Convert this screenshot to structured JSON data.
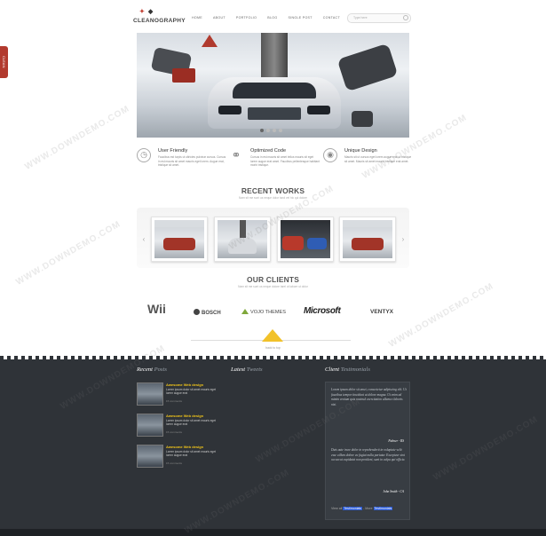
{
  "side_tab": {
    "label": "CLEAN"
  },
  "header": {
    "logo_mark": "CLEANOGRAPHY",
    "logo_text": "CLEANOGRAPHY",
    "nav": [
      "HOME",
      "ABOUT",
      "PORTFOLIO",
      "BLOG",
      "SINGLE POST",
      "CONTACT"
    ],
    "search_placeholder": "Type here"
  },
  "features": [
    {
      "title": "User Friendly",
      "text": "Faucibus est turpis ut ultricies pulvinar cursus. Cursus in est mauris sit amet mauris eget lorem. Augue erat, tristique sit amet."
    },
    {
      "title": "Optimized Code",
      "text": "Cursus in est mauris sit amet tellus mauris sit eget lorem augue erat amet. Faucibus pellentesque habitant morbi tristique."
    },
    {
      "title": "Unique Design",
      "text": "Mauris sit ut cursus eget lorem augue erat ut tristique sit amet. Mauris sit amet mauris tristique erat amet."
    }
  ],
  "recent_works": {
    "title": "RECENT WORKS",
    "subtitle": "Nam sit me sunt us neque dolor tarol vel hic qui dolore"
  },
  "clients": {
    "title": "OUR CLIENTS",
    "subtitle": "Nam sit me sunt us neque dolore tarel ut labore ut dolor",
    "logos": [
      "Wii",
      "BOSCH",
      "VOJO THEMES",
      "Microsoft",
      "VENTYX"
    ]
  },
  "back_to_top": "back to top",
  "footer": {
    "recent_posts_heading": "Recent",
    "recent_posts_accent": "Posts",
    "latest_tweets_heading": "Latest",
    "latest_tweets_accent": "Tweets",
    "testimonials_heading": "Client",
    "testimonials_accent": "Testimonials",
    "posts": [
      {
        "title": "Awesome Web design",
        "text": "Lorem ipsum dolor sit amet mauris eget lorem augue erat",
        "meta": "15 comments"
      },
      {
        "title": "Awesome Web design",
        "text": "Lorem ipsum dolor sit amet mauris eget lorem augue erat",
        "meta": "15 comments"
      },
      {
        "title": "Awesome Web design",
        "text": "Lorem ipsum dolor sit amet mauris eget lorem augue erat",
        "meta": "15 comments"
      }
    ],
    "quotes": [
      {
        "text": "Lorem ipsum dolor sit amet, consectetur adipiscing elit. Ut faucibus tempor tincidunt ut dolore magna. Ut enim ad minim veniam quis nostrud exercitation ullamco laboris nisi.",
        "author": "Palmer - RS"
      },
      {
        "text": "Duis aute irure dolor in reprehenderit in voluptate velit esse cillum dolore eu fugiat nulla pariatur. Excepteur sint occaecat cupidatat non proident, sunt in culpa qui officia.",
        "author": "John Smith - CA"
      }
    ],
    "testimonial_nav": {
      "prefix": "View all",
      "link": "Testimonials",
      "suffix": "- More",
      "link2": "Testimonials"
    }
  },
  "watermark": "WWW.DOWNDEMO.COM",
  "colors": {
    "accent": "#f2c22a",
    "footer_bg": "#2f3338",
    "side_tab": "#b23a2e",
    "post_title": "#f0c419"
  }
}
